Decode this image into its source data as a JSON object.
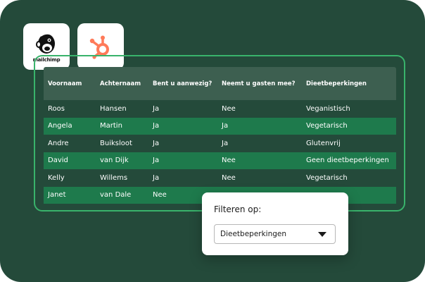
{
  "logos": {
    "mailchimp_word": "mailchimp"
  },
  "table": {
    "headers": [
      "Voornaam",
      "Achternaam",
      "Bent u aanwezig?",
      "Neemt u gasten mee?",
      "Dieetbeperkingen"
    ],
    "rows": [
      [
        "Roos",
        "Hansen",
        "Ja",
        "Nee",
        "Veganistisch"
      ],
      [
        "Angela",
        "Martin",
        "Ja",
        "Ja",
        "Vegetarisch"
      ],
      [
        "Andre",
        "Buiksloot",
        "Ja",
        "Ja",
        "Glutenvrij"
      ],
      [
        "David",
        "van Dijk",
        "Ja",
        "Nee",
        "Geen dieetbeperkingen"
      ],
      [
        "Kelly",
        "Willems",
        "Ja",
        "Nee",
        "Vegetarisch"
      ],
      [
        "Janet",
        "van Dale",
        "Nee",
        "",
        ""
      ]
    ]
  },
  "filter": {
    "label": "Filteren op:",
    "selected": "Dieetbeperkingen"
  },
  "colors": {
    "background": "#244a3a",
    "panel_border": "#39b36b",
    "header_bg": "#3d5f50",
    "alt_row": "#1e7a4c",
    "hubspot_orange": "#ff7a59"
  }
}
